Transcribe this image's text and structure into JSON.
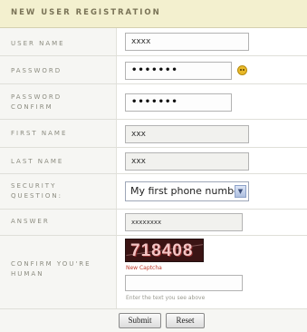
{
  "form": {
    "title": "NEW USER REGISTRATION",
    "fields": {
      "username": {
        "label": "USER NAME",
        "value": "xxxx"
      },
      "password": {
        "label": "PASSWORD",
        "value": "•••••••"
      },
      "password_confirm": {
        "label": "PASSWORD\nCONFIRM",
        "value": "•••••••"
      },
      "first_name": {
        "label": "FIRST NAME",
        "value": "xxx"
      },
      "last_name": {
        "label": "LAST NAME",
        "value": "xxx"
      },
      "security_question": {
        "label": "SECURITY\nQUESTION:",
        "value": "My first phone number"
      },
      "answer": {
        "label": "ANSWER",
        "value": "xxxxxxxx"
      },
      "captcha": {
        "label": "CONFIRM YOU'RE\nHUMAN",
        "code": "718408",
        "new_link": "New Captcha",
        "hint": "Enter the text you see above",
        "value": ""
      }
    },
    "buttons": {
      "submit": "Submit",
      "reset": "Reset"
    },
    "password_strength_icon": "smiley-icon"
  }
}
